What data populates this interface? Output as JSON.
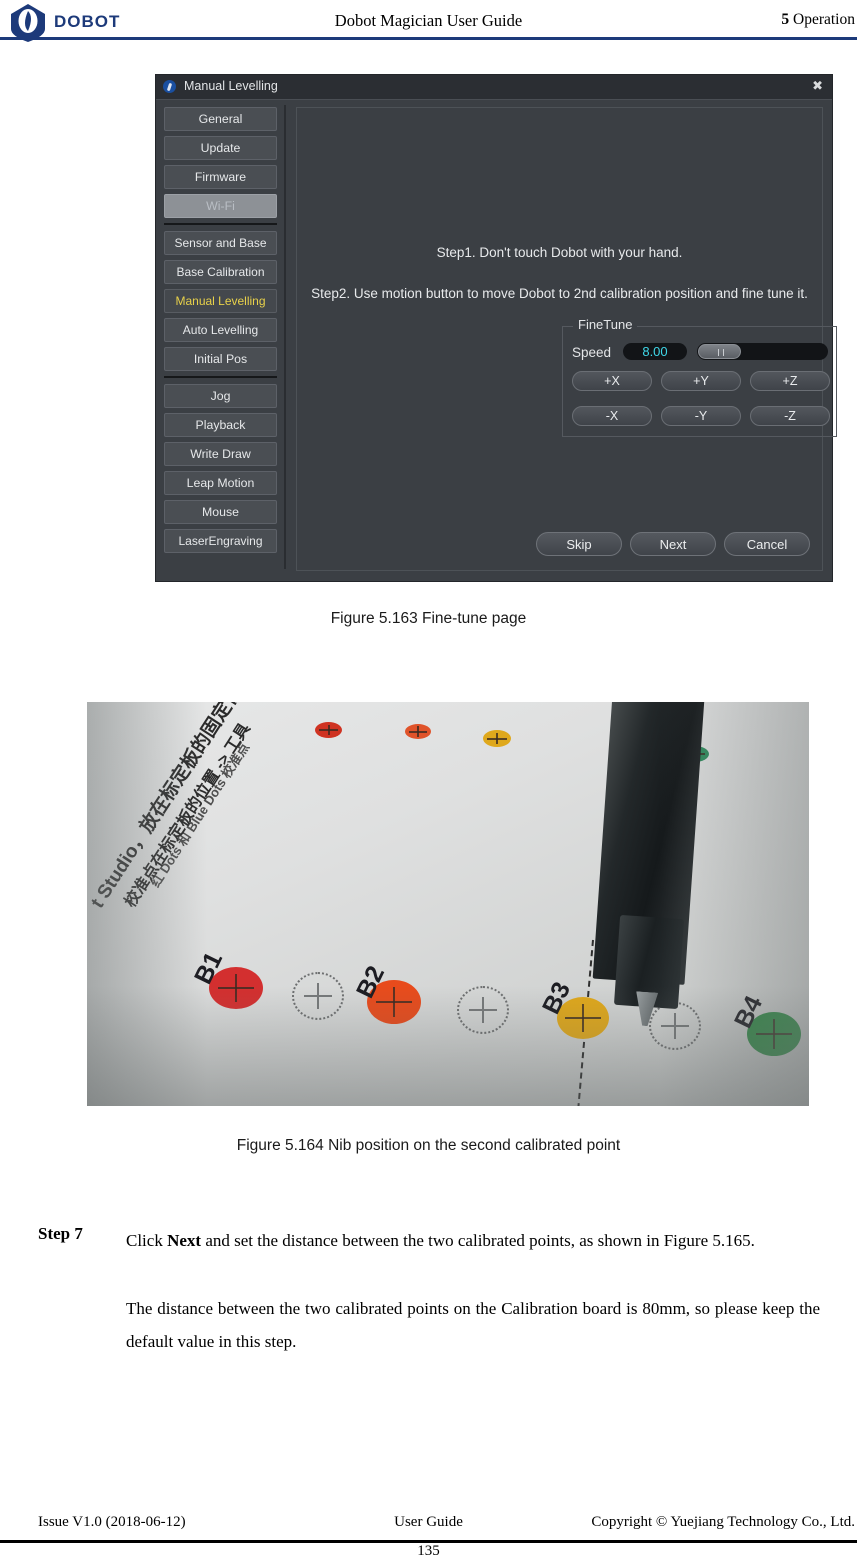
{
  "header": {
    "logo_text": "DOBOT",
    "title": "Dobot Magician User Guide",
    "chapter_num": "5",
    "chapter_name": " Operation"
  },
  "dialog": {
    "title": "Manual Levelling",
    "close_label": "✖",
    "sidebar_group_1": [
      {
        "label": "General",
        "state": "normal"
      },
      {
        "label": "Update",
        "state": "normal"
      },
      {
        "label": "Firmware",
        "state": "normal"
      },
      {
        "label": "Wi-Fi",
        "state": "disabled"
      }
    ],
    "sidebar_group_2": [
      {
        "label": "Sensor and Base",
        "state": "normal"
      },
      {
        "label": "Base Calibration",
        "state": "normal"
      },
      {
        "label": "Manual Levelling",
        "state": "active"
      },
      {
        "label": "Auto Levelling",
        "state": "normal"
      },
      {
        "label": "Initial Pos",
        "state": "normal"
      }
    ],
    "sidebar_group_3": [
      {
        "label": "Jog",
        "state": "normal"
      },
      {
        "label": "Playback",
        "state": "normal"
      },
      {
        "label": "Write  Draw",
        "state": "normal"
      },
      {
        "label": "Leap Motion",
        "state": "normal"
      },
      {
        "label": "Mouse",
        "state": "normal"
      },
      {
        "label": "LaserEngraving",
        "state": "normal"
      }
    ],
    "step1": "Step1. Don't touch Dobot with your hand.",
    "step2": "Step2. Use motion button to move Dobot to 2nd calibration position and fine tune it.",
    "finetune": {
      "legend": "FineTune",
      "speed_label": "Speed",
      "speed_value": "8.00",
      "speed_value_color": "#3fd7e8",
      "slider_percent": 12,
      "buttons_row1": [
        "+X",
        "+Y",
        "+Z"
      ],
      "buttons_row2": [
        "-X",
        "-Y",
        "-Z"
      ]
    },
    "actions": [
      "Skip",
      "Next",
      "Cancel"
    ]
  },
  "figure_163": {
    "caption": "Figure 5.163    Fine-tune page"
  },
  "figure_164": {
    "caption": "Figure 5.164    Nib position on the second calibrated point",
    "point_labels": [
      "B1",
      "B2",
      "B3",
      "B4"
    ],
    "dot_colors": [
      "#d32f2f",
      "#e84b1c",
      "#e0a81b",
      "#2f8a45"
    ],
    "board_text_lines": [
      "t Studio，放在标定板的固定位置",
      "校准点在标定板的位置 -> 工具",
      "红 Dots 和 Blue Dots 校准点"
    ]
  },
  "step7": {
    "label": "Step 7",
    "paragraph1_pre": "Click ",
    "paragraph1_bold": "Next",
    "paragraph1_post": " and set the distance between the two calibrated points, as shown in Figure 5.165.",
    "paragraph2": "The distance between the two calibrated points on the Calibration board is 80mm, so please keep the default value in this step."
  },
  "footer": {
    "left": "Issue V1.0 (2018-06-12)",
    "center": "User Guide",
    "right": "Copyright © Yuejiang Technology Co., Ltd.",
    "page_number": "135"
  }
}
